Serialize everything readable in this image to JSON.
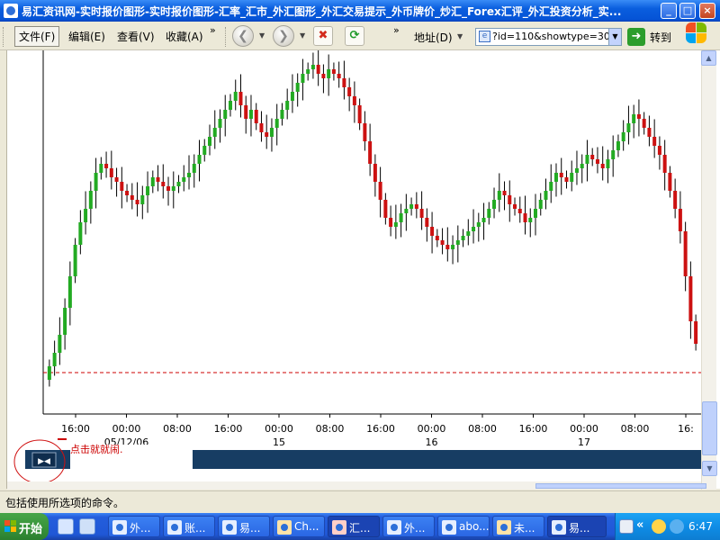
{
  "window": {
    "title": "易汇资讯网-实时报价图形-实时报价图形-汇率_汇市_外汇图形_外汇交易提示_外币牌价_炒汇_Forex汇评_外汇投资分析_实...",
    "buttons": {
      "minimize": "_",
      "maximize": "□",
      "close": "×"
    }
  },
  "menu": {
    "items": [
      {
        "label": "文件(F)",
        "active": true
      },
      {
        "label": "编辑(E)"
      },
      {
        "label": "查看(V)"
      },
      {
        "label": "收藏(A)"
      }
    ],
    "more": "»"
  },
  "navbar": {
    "back_icon": "back-arrow-icon",
    "forward_icon": "forward-arrow-icon",
    "stop_icon": "stop-icon",
    "refresh_icon": "refresh-icon",
    "more": "»",
    "address_label": "地址(D)",
    "address_value": "?id=110&showtype=30&",
    "go_label": "转到"
  },
  "chart_data": {
    "type": "candlestick",
    "reference_line_color": "#cc0000",
    "x_ticks": [
      {
        "label": "16:00",
        "sub": ""
      },
      {
        "label": "00:00",
        "sub": "05/12/06"
      },
      {
        "label": "08:00",
        "sub": ""
      },
      {
        "label": "16:00",
        "sub": ""
      },
      {
        "label": "00:00",
        "sub": "15"
      },
      {
        "label": "08:00",
        "sub": ""
      },
      {
        "label": "16:00",
        "sub": ""
      },
      {
        "label": "00:00",
        "sub": "16"
      },
      {
        "label": "08:00",
        "sub": ""
      },
      {
        "label": "16:00",
        "sub": ""
      },
      {
        "label": "00:00",
        "sub": "17"
      },
      {
        "label": "08:00",
        "sub": ""
      },
      {
        "label": "16:",
        "sub": ""
      }
    ],
    "up_color": "#22aa22",
    "down_color": "#cc1111",
    "closes": [
      35,
      38,
      42,
      48,
      55,
      62,
      67,
      70,
      74,
      78,
      80,
      79,
      77,
      76,
      74,
      73,
      72,
      71,
      73,
      75,
      77,
      76,
      75,
      74,
      75,
      76,
      77,
      78,
      80,
      82,
      84,
      86,
      88,
      90,
      92,
      94,
      96,
      93,
      90,
      92,
      89,
      87,
      86,
      88,
      90,
      92,
      94,
      96,
      98,
      100,
      101,
      102,
      100,
      99,
      101,
      100,
      99,
      97,
      95,
      93,
      89,
      85,
      80,
      76,
      72,
      68,
      66,
      67,
      69,
      70,
      71,
      70,
      68,
      66,
      64,
      63,
      62,
      61,
      62,
      63,
      64,
      65,
      66,
      67,
      68,
      70,
      72,
      74,
      73,
      71,
      70,
      69,
      67,
      68,
      70,
      72,
      74,
      76,
      78,
      77,
      76,
      78,
      79,
      80,
      82,
      81,
      80,
      79,
      81,
      83,
      85,
      87,
      89,
      91,
      90,
      88,
      86,
      84,
      82,
      78,
      74,
      70,
      65,
      55,
      45,
      40
    ]
  },
  "banner": {
    "annotation": "点击就就闹."
  },
  "status": {
    "text": "包括使用所选项的命令。"
  },
  "taskbar": {
    "start_label": "开始",
    "tasks": [
      {
        "label": "外...",
        "active": false
      },
      {
        "label": "账...",
        "active": false
      },
      {
        "label": "易...",
        "active": false
      },
      {
        "label": "Ch...",
        "active": false
      },
      {
        "label": "汇...",
        "active": true
      },
      {
        "label": "外...",
        "active": false
      },
      {
        "label": "abo...",
        "active": false
      },
      {
        "label": "未...",
        "active": false
      },
      {
        "label": "易...",
        "active": true
      }
    ],
    "tray_chevron": "«",
    "time": "6:47"
  }
}
